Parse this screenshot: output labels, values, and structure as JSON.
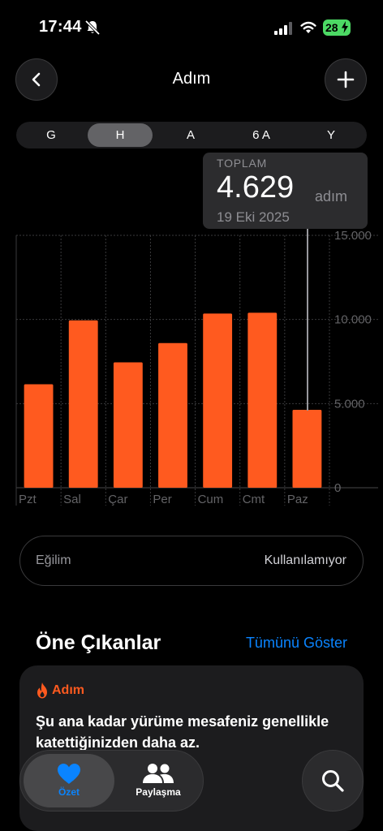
{
  "status": {
    "time": "17:44",
    "battery": "28"
  },
  "nav": {
    "title": "Adım"
  },
  "segments": [
    "G",
    "H",
    "A",
    "6 A",
    "Y"
  ],
  "segment_selected": "H",
  "tooltip": {
    "label": "TOPLAM",
    "value": "4.629",
    "unit": "adım",
    "date": "19 Eki 2025"
  },
  "chart_data": {
    "type": "bar",
    "categories": [
      "Pzt",
      "Sal",
      "Çar",
      "Per",
      "Cum",
      "Cmt",
      "Paz"
    ],
    "values": [
      6150,
      9950,
      7450,
      8600,
      10350,
      10400,
      4629
    ],
    "ylim": [
      0,
      15000
    ],
    "yticks": [
      0,
      5000,
      10000,
      15000
    ],
    "ytick_labels": [
      "0",
      "5.000",
      "10.000",
      "15.000"
    ],
    "grid": true,
    "bar_color": "#ff5a1f",
    "selected_index": 6
  },
  "trend": {
    "label": "Eğilim",
    "value": "Kullanılamıyor"
  },
  "highlights": {
    "title": "Öne Çıkanlar",
    "show_all": "Tümünü Göster",
    "card": {
      "icon": "flame-icon",
      "label": "Adım",
      "text": "Şu ana kadar yürüme mesafeniz genellikle katettiğinizden daha az."
    }
  },
  "tabs": [
    {
      "label": "Özet",
      "icon": "heart-icon",
      "active": true
    },
    {
      "label": "Paylaşma",
      "icon": "people-icon",
      "active": false
    }
  ],
  "colors": {
    "accent": "#0a84ff",
    "steps": "#ff5a1f"
  }
}
